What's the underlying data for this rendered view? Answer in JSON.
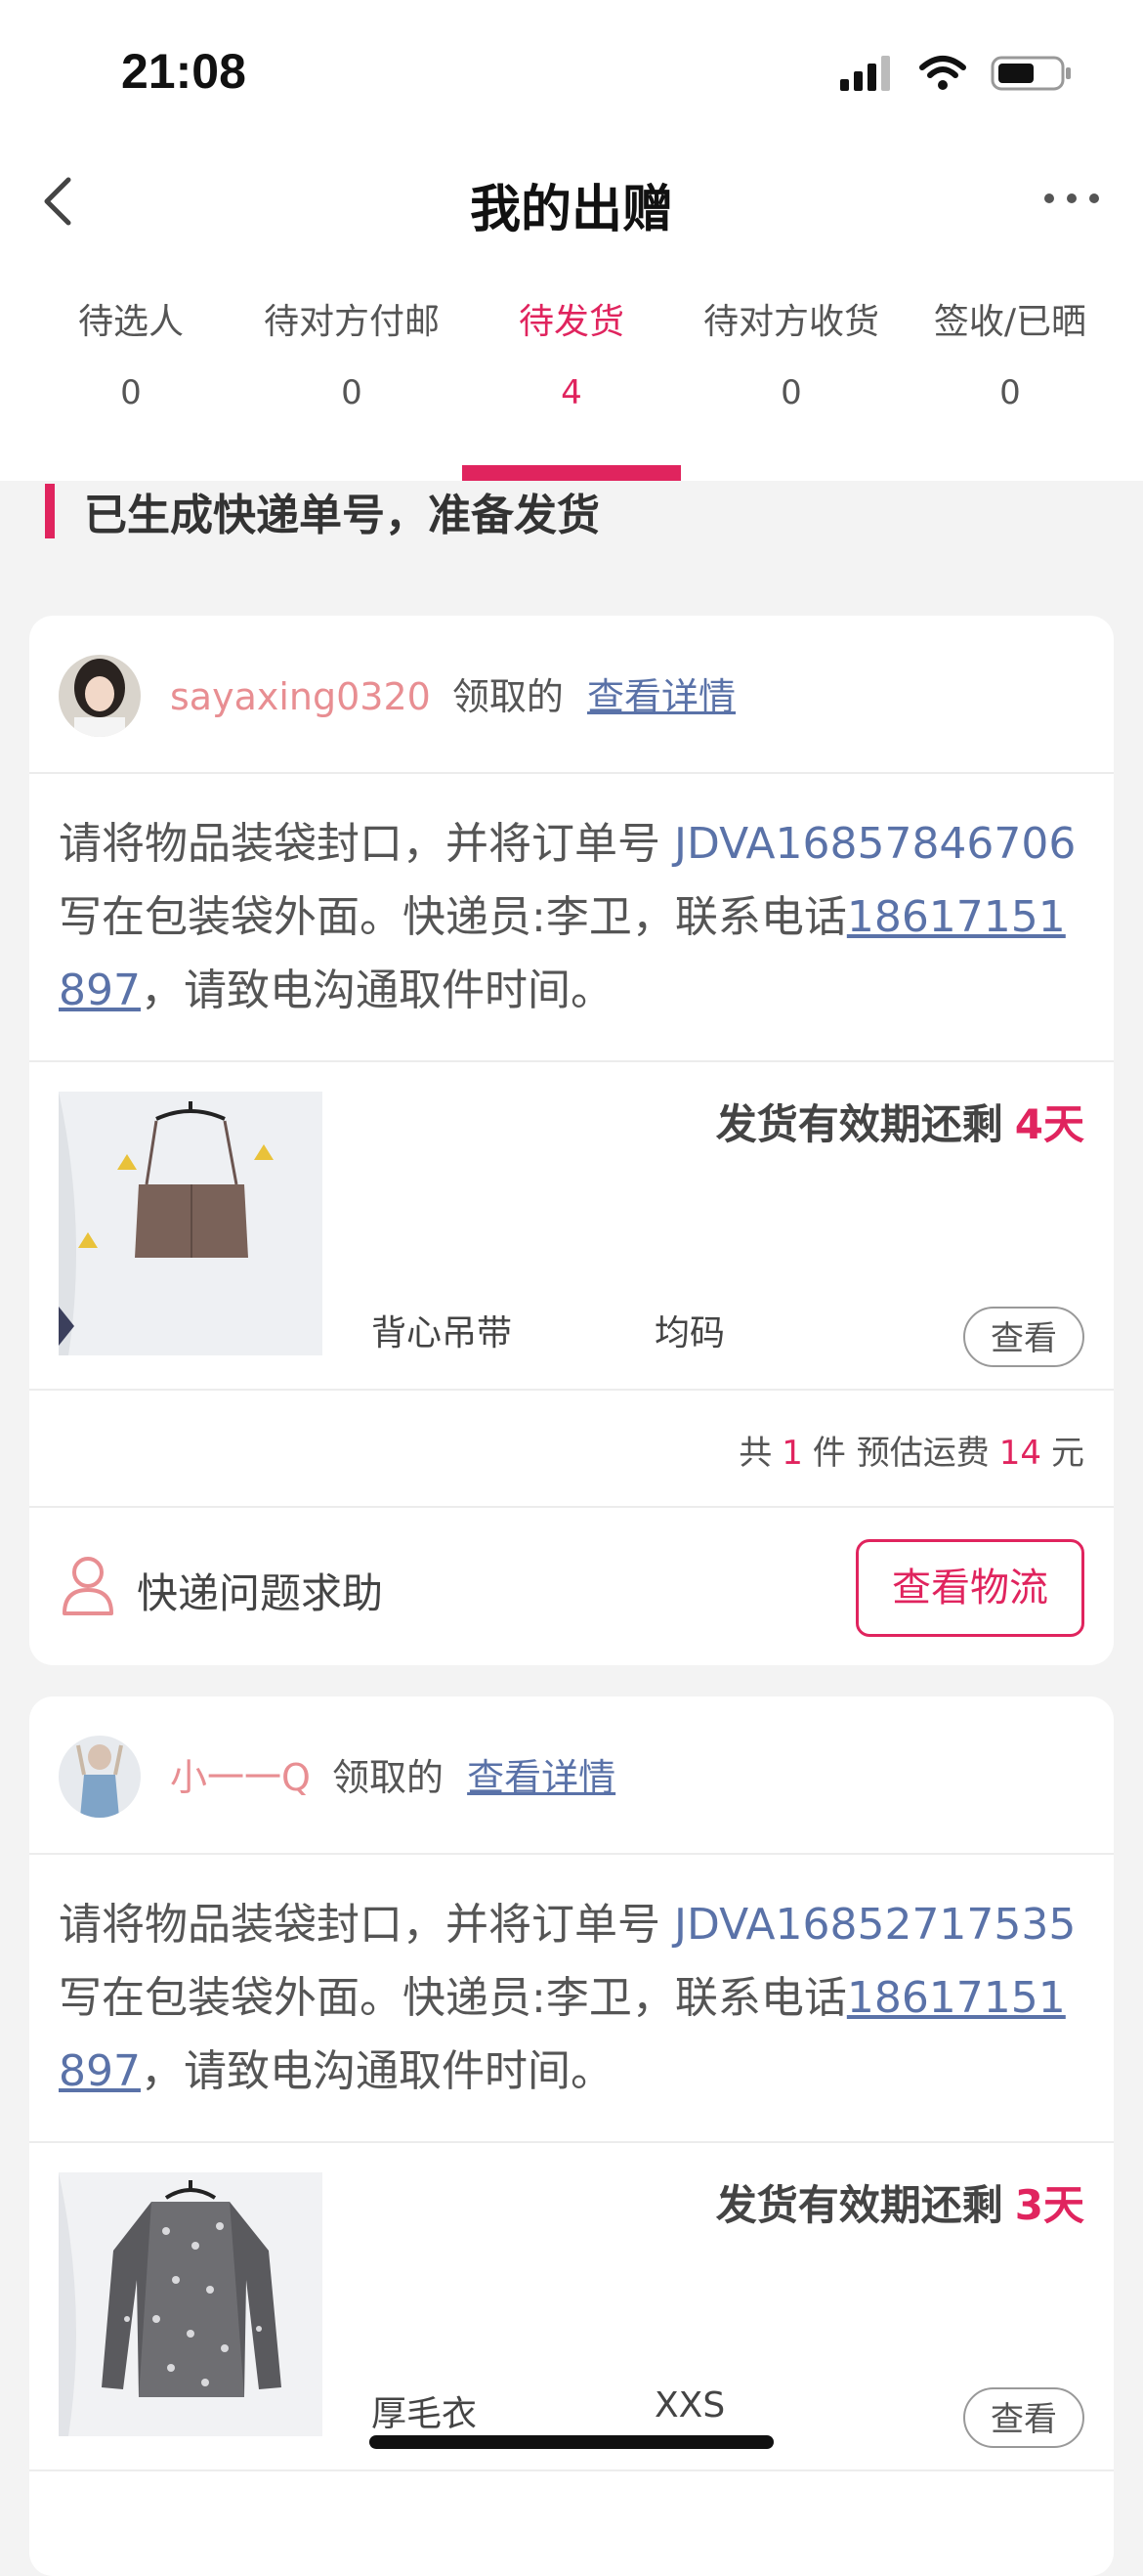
{
  "status_bar": {
    "time": "21:08"
  },
  "nav": {
    "title": "我的出赠"
  },
  "tabs": [
    {
      "label": "待选人",
      "count": "0"
    },
    {
      "label": "待对方付邮",
      "count": "0"
    },
    {
      "label": "待发货",
      "count": "4",
      "active": true
    },
    {
      "label": "待对方收货",
      "count": "0"
    },
    {
      "label": "签收/已晒",
      "count": "0"
    }
  ],
  "section": {
    "title": "已生成快递单号，准备发货"
  },
  "cards": [
    {
      "username": "sayaxing0320",
      "taken_label": "领取的",
      "detail_link": "查看详情",
      "instruction": {
        "part1": "请将物品装袋封口，并将订单号 ",
        "order_no": "JDVA16857846706",
        "part2": " 写在包装袋外面。快递员:李卫，联系电话",
        "phone": "18617151897",
        "part3": "，请致电沟通取件时间。"
      },
      "deadline_label": "发货有效期还剩",
      "deadline_days": "4天",
      "item_name": "背心吊带",
      "item_size": "均码",
      "view_button": "查看",
      "summary": {
        "prefix": "共",
        "count": "1",
        "mid": "件 预估运费",
        "fee": "14",
        "unit": "元"
      },
      "help_text": "快递问题求助",
      "logistics_button": "查看物流"
    },
    {
      "username": "小一一Q",
      "taken_label": "领取的",
      "detail_link": "查看详情",
      "instruction": {
        "part1": "请将物品装袋封口，并将订单号 ",
        "order_no": "JDVA16852717535",
        "part2": " 写在包装袋外面。快递员:李卫，联系电话",
        "phone": "18617151897",
        "part3": "，请致电沟通取件时间。"
      },
      "deadline_label": "发货有效期还剩",
      "deadline_days": "3天",
      "item_name": "厚毛衣",
      "item_size": "XXS",
      "view_button": "查看"
    }
  ],
  "colors": {
    "accent": "#e0245e",
    "link": "#5a72a8",
    "username": "#e88e92"
  },
  "icons": [
    "signal-icon",
    "wifi-icon",
    "battery-icon",
    "back-chevron-icon",
    "more-dots-icon",
    "person-outline-icon"
  ]
}
